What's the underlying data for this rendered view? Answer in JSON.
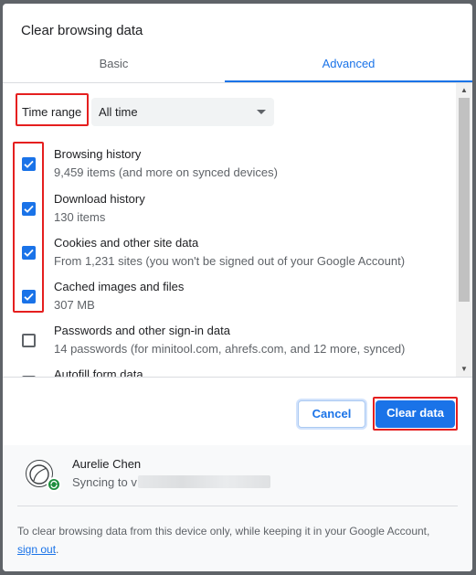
{
  "dialog": {
    "title": "Clear browsing data",
    "tabs": [
      {
        "label": "Basic",
        "active": false
      },
      {
        "label": "Advanced",
        "active": true
      }
    ]
  },
  "time_range": {
    "label": "Time range",
    "selected": "All time"
  },
  "items": [
    {
      "title": "Browsing history",
      "subtitle": "9,459 items (and more on synced devices)",
      "checked": true
    },
    {
      "title": "Download history",
      "subtitle": "130 items",
      "checked": true
    },
    {
      "title": "Cookies and other site data",
      "subtitle": "From 1,231 sites (you won't be signed out of your Google Account)",
      "checked": true
    },
    {
      "title": "Cached images and files",
      "subtitle": "307 MB",
      "checked": true
    },
    {
      "title": "Passwords and other sign-in data",
      "subtitle": "14 passwords (for minitool.com, ahrefs.com, and 12 more, synced)",
      "checked": false
    },
    {
      "title": "Autofill form data",
      "subtitle": "",
      "checked": false
    }
  ],
  "buttons": {
    "cancel": "Cancel",
    "clear": "Clear data"
  },
  "account": {
    "name": "Aurelie Chen",
    "sync_prefix": "Syncing to v"
  },
  "footer": {
    "text": "To clear browsing data from this device only, while keeping it in your Google Account, ",
    "link": "sign out",
    "end": "."
  },
  "colors": {
    "accent": "#1a73e8",
    "highlight": "#e51f1f",
    "sync_badge": "#1e8e3e"
  }
}
